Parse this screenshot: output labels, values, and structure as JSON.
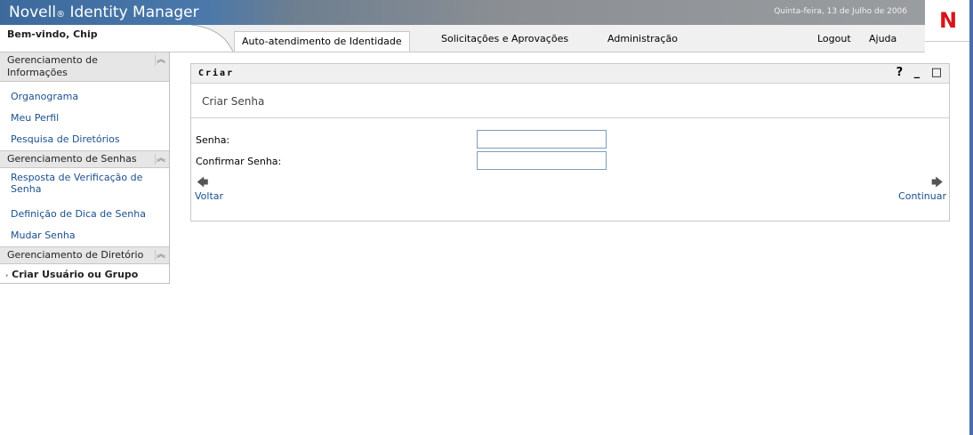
{
  "header": {
    "brand_prefix": "Novell",
    "brand_reg": "®",
    "brand_name": " Identity Manager",
    "date": "Quinta-feira, 13 de Julho de 2006",
    "logo": "N",
    "welcome": "Bem-vindo, Chip"
  },
  "tabs": [
    {
      "label": "Auto-atendimento de Identidade",
      "active": true
    },
    {
      "label": "Solicitações e Aprovações"
    },
    {
      "label": "Administração"
    }
  ],
  "top_links": {
    "logout": "Logout",
    "help": "Ajuda"
  },
  "sidebar": {
    "sections": [
      {
        "title": "Gerenciamento de Informações",
        "items": [
          "Organograma",
          "Meu Perfil",
          "Pesquisa de Diretórios"
        ]
      },
      {
        "title": "Gerenciamento de Senhas",
        "items": [
          "Resposta de Verificação de Senha",
          "Definição de Dica de Senha",
          "Mudar Senha"
        ]
      },
      {
        "title": "Gerenciamento de Diretório",
        "items": [
          "Criar Usuário ou Grupo"
        ]
      }
    ],
    "collapse_icon": "double-chevron-up-icon"
  },
  "panel": {
    "title": "Criar",
    "icons": {
      "help": "?",
      "minimize": "_",
      "maximize": "□"
    },
    "subheading": "Criar Senha",
    "fields": {
      "password_label": "Senha:",
      "password_value": "",
      "confirm_label": "Confirmar Senha:",
      "confirm_value": ""
    },
    "back": "Voltar",
    "next": "Continuar"
  }
}
